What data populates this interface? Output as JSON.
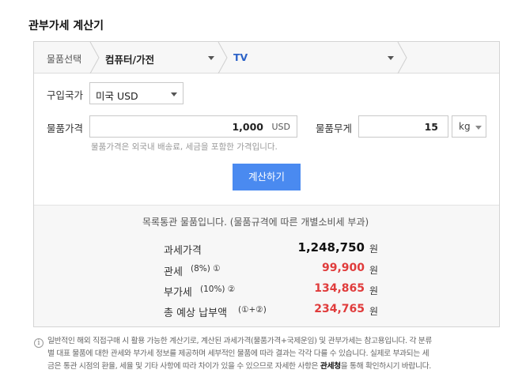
{
  "page": {
    "title": "관부가세 계산기"
  },
  "product_select": {
    "label": "물품선택",
    "category": "컴퓨터/가전",
    "subcategory": "TV"
  },
  "country": {
    "label": "구입국가",
    "value": "미국 USD"
  },
  "price": {
    "label": "물품가격",
    "value": "1,000",
    "unit": "USD",
    "hint": "물품가격은 외국내 배송료, 세금을 포함한 가격입니다."
  },
  "weight": {
    "label": "물품무게",
    "value": "15",
    "unit": "kg"
  },
  "calc_button": "계산하기",
  "result": {
    "notice": "목록통관 물품입니다. (물품규격에 따른 개별소비세 부과)",
    "rows": [
      {
        "label": "과세가격",
        "suffix": "",
        "value": "1,248,750",
        "unit": "원",
        "color": "#111111"
      },
      {
        "label": "관세",
        "suffix": "(8%) ①",
        "value": "99,900",
        "unit": "원",
        "color": "#e03c3c"
      },
      {
        "label": "부가세",
        "suffix": "(10%) ②",
        "value": "134,865",
        "unit": "원",
        "color": "#e03c3c"
      },
      {
        "label": "총 예상 납부액",
        "suffix": "(①+②)",
        "value": "234,765",
        "unit": "원",
        "color": "#e03c3c"
      }
    ]
  },
  "footnote": {
    "icon": "info-icon",
    "line1": "일반적인 해외 직접구매 시 활용 가능한 계산기로, 계산된 과세가격(물품가격+국제운임) 및 관부가세는 참고용입니다. 각 분류",
    "line2": "별 대표 물품에 대한 관세와 부가세 정보를 제공하며 세부적인 물품에 따라 결과는 각각 다를 수 있습니다. 실제로 부과되는 세",
    "line3_before": "금은 통관 시점의 환율, 세율 및 기타 사항에 따라 차이가 있을 수 있으므로 자세한 사항은 ",
    "line3_link": "관세청",
    "line3_after": "을 통해 확인하시기 바랍니다."
  }
}
